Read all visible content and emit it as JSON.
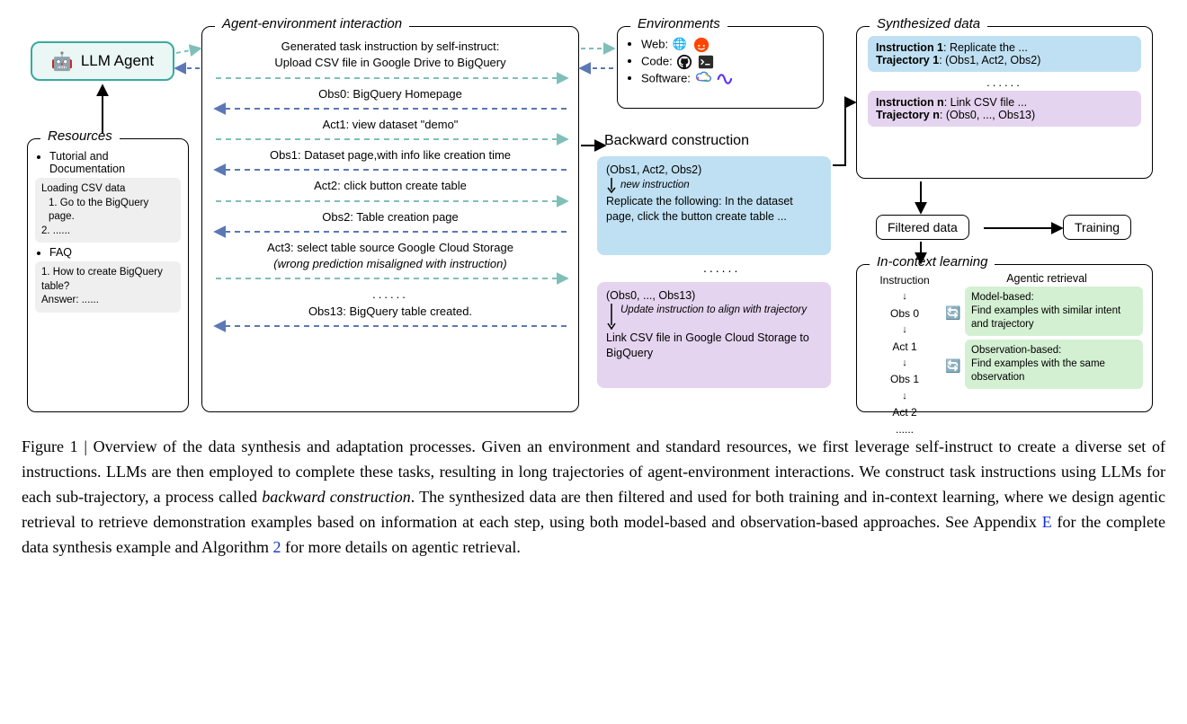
{
  "agent": {
    "label": "LLM Agent"
  },
  "resources": {
    "legend": "Resources",
    "item1": "Tutorial and Documentation",
    "tut_title": "Loading CSV data",
    "tut_step1": "1. Go to the BigQuery page.",
    "tut_step2": "2. ......",
    "item2": "FAQ",
    "faq_q": "1. How to create BigQuery table?",
    "faq_a": "Answer: ......"
  },
  "interaction": {
    "legend": "Agent-environment interaction",
    "gen1": "Generated task instruction by self-instruct:",
    "gen2": "Upload CSV file in Google Drive to BigQuery",
    "obs0": "Obs0: BigQuery Homepage",
    "act1": "Act1: view dataset \"demo\"",
    "obs1": "Obs1: Dataset page,with info like creation time",
    "act2": "Act2: click button create table",
    "obs2": "Obs2: Table creation page",
    "act3a": "Act3: select table source Google Cloud Storage",
    "act3b": "(wrong prediction misaligned with instruction)",
    "dots": "......",
    "obs13": "Obs13: BigQuery table created."
  },
  "envs": {
    "legend": "Environments",
    "web": "Web:",
    "code": "Code:",
    "software": "Software:"
  },
  "backward": {
    "title": "Backward construction",
    "b1_line1": "(Obs1, Act2, Obs2)",
    "b1_note": "new instruction",
    "b1_body": "Replicate the following: In the dataset page, click the button create table ...",
    "dots": "......",
    "b2_line1": "(Obs0, ..., Obs13)",
    "b2_note": "Update  instruction to align with trajectory",
    "b2_body": "Link CSV file in Google Cloud Storage to BigQuery"
  },
  "synth": {
    "legend": "Synthesized data",
    "i1a": "Instruction 1",
    "i1b": ": Replicate the ...",
    "t1a": "Trajectory 1",
    "t1b": ": (Obs1, Act2, Obs2)",
    "dots": "......",
    "ina": "Instruction n",
    "inb": ": Link CSV file ...",
    "tna": "Trajectory n",
    "tnb": ": (Obs0, ..., Obs13)"
  },
  "filtered": "Filtered data",
  "training": "Training",
  "icl": {
    "legend": "In-context learning",
    "col_head": "Instruction",
    "seq": [
      "Obs 0",
      "Act 1",
      "Obs 1",
      "Act 2",
      "......"
    ],
    "ar_title": "Agentic retrieval",
    "model_h": "Model-based:",
    "model_b": "Find examples with similar intent and trajectory",
    "obs_h": "Observation-based:",
    "obs_b": "Find examples with the same observation"
  },
  "caption": {
    "prefix": "Figure 1 | ",
    "body": "Overview of the data synthesis and adaptation processes. Given an environment and standard resources, we first leverage self-instruct to create a diverse set of instructions. LLMs are then employed to complete these tasks, resulting in long trajectories of agent-environment interactions. We construct task instructions using LLMs for each sub-trajectory, a process called ",
    "emph": "backward construction",
    "body2": ". The synthesized data are then filtered and used for both training and in-context learning, where we design agentic retrieval to retrieve demonstration examples based on information at each step, using both model-based and observation-based approaches. See Appendix ",
    "linkE": "E",
    "body3": " for the complete data synthesis example and Algorithm ",
    "link2": "2",
    "body4": " for more details on agentic retrieval."
  }
}
